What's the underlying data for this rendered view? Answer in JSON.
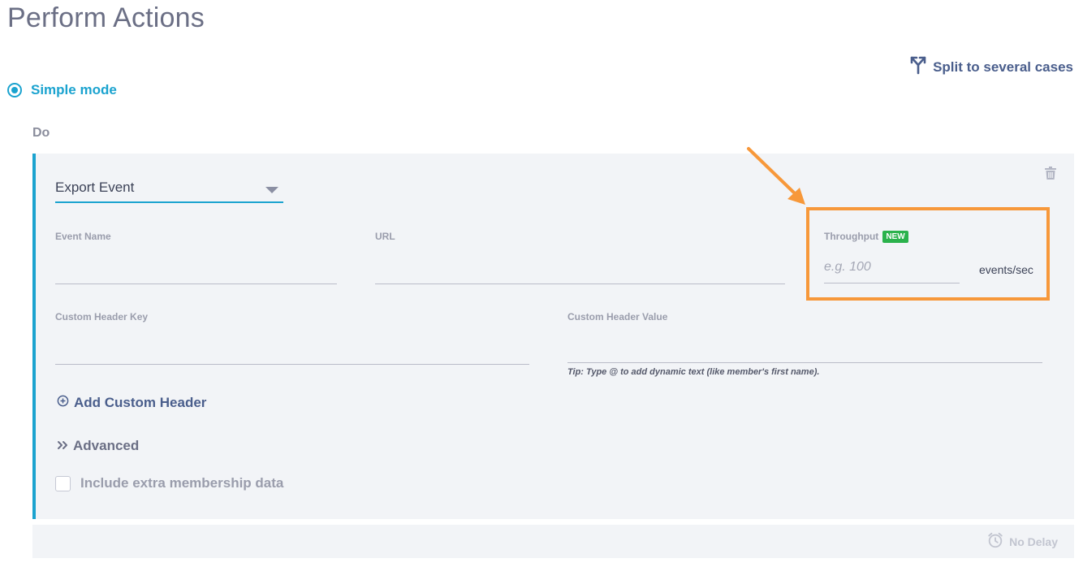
{
  "page": {
    "title": "Perform Actions"
  },
  "split": {
    "label": "Split to several cases"
  },
  "mode": {
    "label": "Simple mode",
    "selected": true
  },
  "do_label": "Do",
  "action": {
    "type_value": "Export Event",
    "event_name": {
      "label": "Event Name",
      "value": ""
    },
    "url": {
      "label": "URL",
      "value": ""
    },
    "throughput": {
      "label": "Throughput",
      "badge": "NEW",
      "placeholder": "e.g. 100",
      "units": "events/sec"
    },
    "custom_header_key": {
      "label": "Custom Header Key",
      "value": ""
    },
    "custom_header_value": {
      "label": "Custom Header Value",
      "value": "",
      "tip": "Tip: Type @ to add dynamic text (like member's first name)."
    },
    "add_header_label": "Add Custom Header",
    "advanced_label": "Advanced",
    "include_membership": {
      "label": "Include extra membership data",
      "checked": false
    }
  },
  "delay": {
    "label": "No Delay"
  },
  "colors": {
    "accent": "#1ba3cf",
    "link": "#4a5e8c",
    "badge_green": "#2bb24c",
    "annotation_orange": "#f7983a",
    "card_bg": "#f2f4f7"
  },
  "icons": {
    "split": "split-icon",
    "trash": "trash-icon",
    "add": "plus-circle-icon",
    "advanced": "double-chevron-right-icon",
    "delay": "alarm-clock-icon"
  }
}
